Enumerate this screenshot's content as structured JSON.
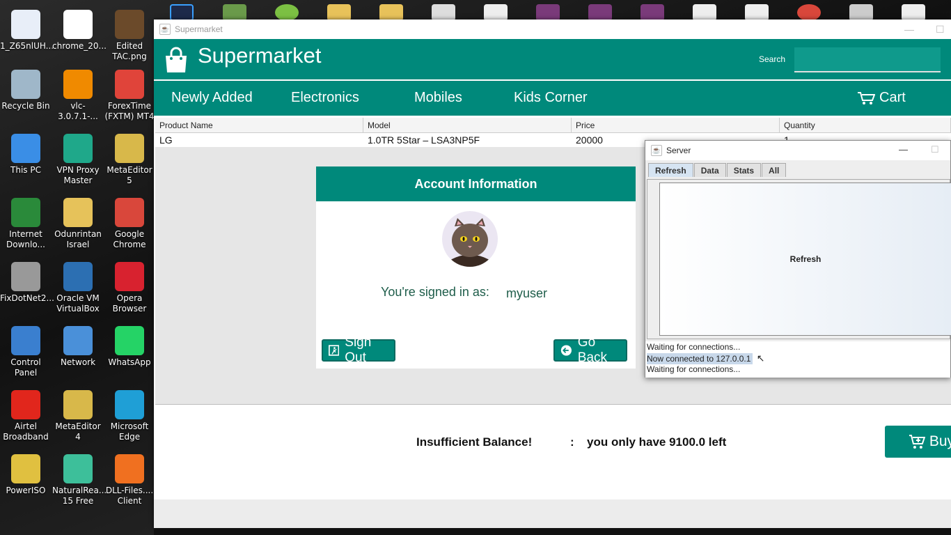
{
  "desktop": {
    "icons": [
      {
        "label": "1_Z65nlUH...",
        "icon": "image-file-icon",
        "color": "#e8eef8"
      },
      {
        "label": "chrome_20...",
        "icon": "image-file-icon",
        "color": "#ffffff"
      },
      {
        "label": "Edited TAC.png",
        "icon": "image-file-icon",
        "color": "#6b4a2a"
      },
      {
        "label": "Recycle Bin",
        "icon": "recycle-bin-icon",
        "color": "#9fb7c9"
      },
      {
        "label": "vlc-3.0.7.1-...",
        "icon": "vlc-icon",
        "color": "#f08a00"
      },
      {
        "label": "ForexTime (FXTM) MT4",
        "icon": "forextime-icon",
        "color": "#e0443a"
      },
      {
        "label": "This PC",
        "icon": "computer-icon",
        "color": "#3a8ee6"
      },
      {
        "label": "VPN Proxy Master",
        "icon": "vpn-icon",
        "color": "#1fa88a"
      },
      {
        "label": "MetaEditor 5",
        "icon": "metaeditor-icon",
        "color": "#d8b84a"
      },
      {
        "label": "Internet Downlo...",
        "icon": "idm-icon",
        "color": "#2a8a3a"
      },
      {
        "label": "Odunrintan Israel",
        "icon": "user-folder-icon",
        "color": "#e6c25a"
      },
      {
        "label": "Google Chrome",
        "icon": "chrome-icon",
        "color": "#d9473b"
      },
      {
        "label": "FixDotNet2...",
        "icon": "fixdotnet-icon",
        "color": "#999999"
      },
      {
        "label": "Oracle VM VirtualBox",
        "icon": "virtualbox-icon",
        "color": "#2c6fb2"
      },
      {
        "label": "Opera Browser",
        "icon": "opera-icon",
        "color": "#d8222f"
      },
      {
        "label": "Control Panel",
        "icon": "control-panel-icon",
        "color": "#3a7fcf"
      },
      {
        "label": "Network",
        "icon": "network-icon",
        "color": "#4a90d9"
      },
      {
        "label": "WhatsApp",
        "icon": "whatsapp-icon",
        "color": "#25d366"
      },
      {
        "label": "Airtel Broadband",
        "icon": "airtel-icon",
        "color": "#e1261c"
      },
      {
        "label": "MetaEditor 4",
        "icon": "metaeditor-icon",
        "color": "#d8b84a"
      },
      {
        "label": "Microsoft Edge",
        "icon": "edge-icon",
        "color": "#1f9fd6"
      },
      {
        "label": "PowerISO",
        "icon": "poweriso-icon",
        "color": "#e0c040"
      },
      {
        "label": "NaturalRea... 15 Free",
        "icon": "naturalreader-icon",
        "color": "#3dbf9a"
      },
      {
        "label": "DLL-Files.... Client",
        "icon": "dll-files-icon",
        "color": "#f07020"
      }
    ]
  },
  "app": {
    "window_title": "Supermarket",
    "brand": "Supermarket",
    "search_label": "Search",
    "search_value": "",
    "nav": [
      "Newly Added",
      "Electronics",
      "Mobiles",
      "Kids Corner"
    ],
    "cart_label": "Cart",
    "table": {
      "columns": [
        "Product Name",
        "Model",
        "Price",
        "Quantity"
      ],
      "rows": [
        [
          "LG",
          "1.0TR 5Star – LSA3NP5F",
          "20000",
          "1"
        ]
      ]
    },
    "account": {
      "title": "Account Information",
      "signed_in_label": "You're signed in as:",
      "username": "myuser",
      "sign_out_label": "Sign Out",
      "go_back_label": "Go Back"
    },
    "footer": {
      "error": "Insufficient Balance!",
      "separator": ":",
      "balance_msg": "you only have 9100.0 left",
      "buy_label": "Buy"
    },
    "colors": {
      "accent": "#00897b"
    }
  },
  "server": {
    "title": "Server",
    "tabs": [
      "Refresh",
      "Data",
      "Stats",
      "All"
    ],
    "active_tab": "Refresh",
    "refresh_button": "Refresh",
    "log": [
      "Waiting for connections...",
      "Now connected to 127.0.0.1",
      "Waiting for connections..."
    ]
  }
}
